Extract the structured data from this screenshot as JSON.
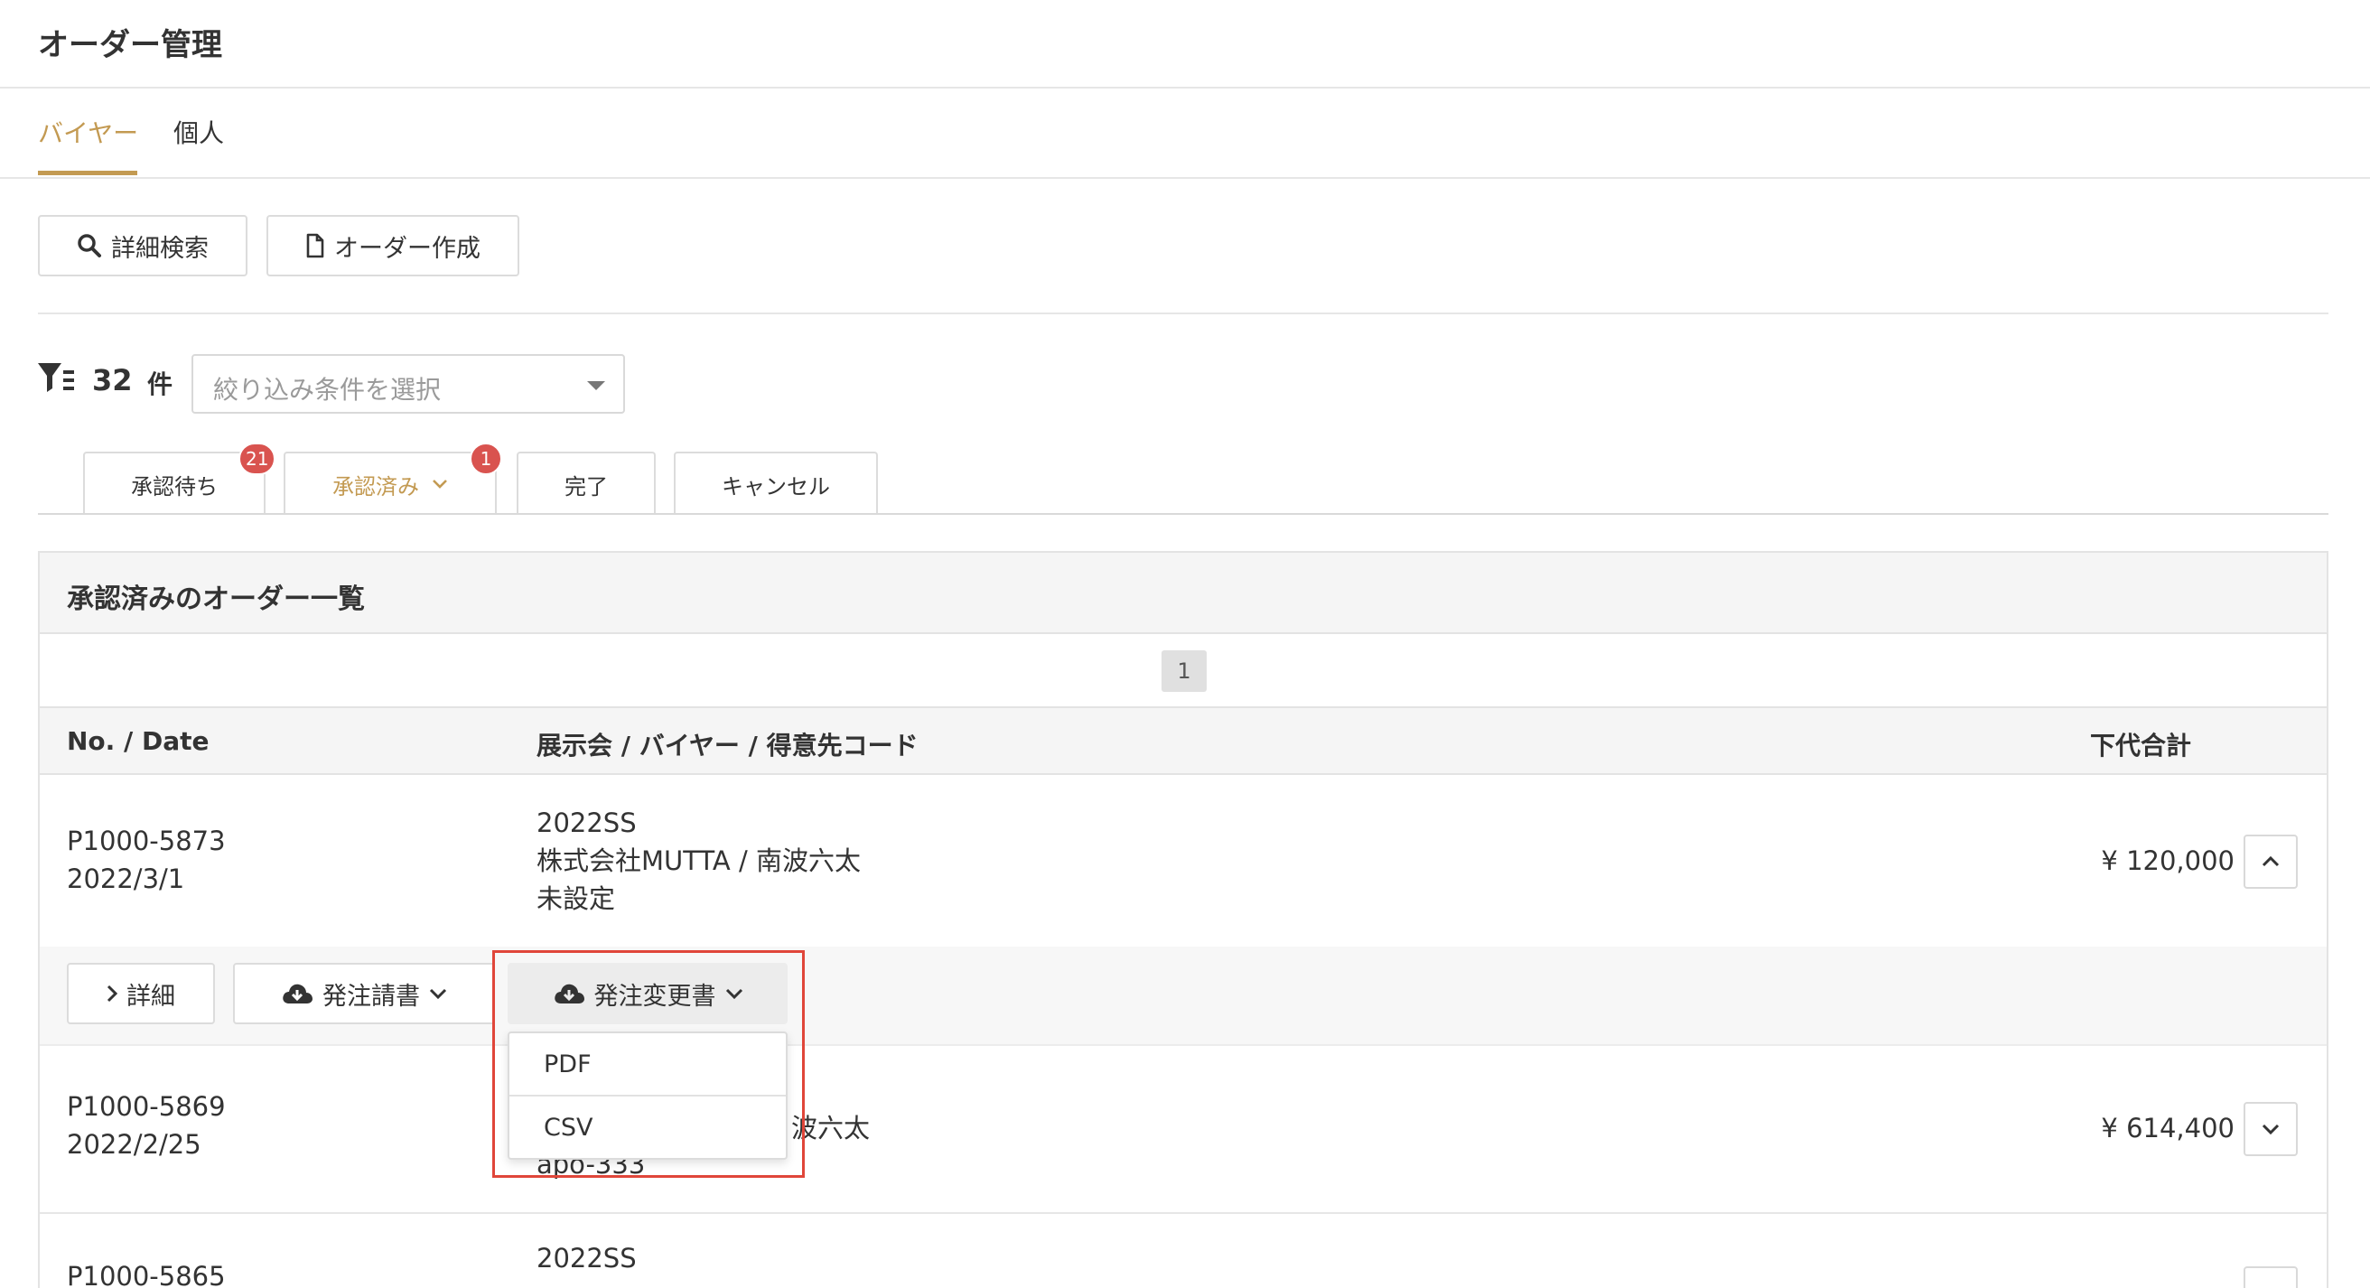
{
  "page": {
    "title": "オーダー管理"
  },
  "top_tabs": [
    {
      "label": "バイヤー",
      "active": true
    },
    {
      "label": "個人",
      "active": false
    }
  ],
  "toolbar": {
    "search_label": "詳細検索",
    "create_label": "オーダー作成"
  },
  "filter": {
    "count": "32",
    "unit": "件",
    "placeholder": "絞り込み条件を選択"
  },
  "status_tabs": [
    {
      "label": "承認待ち",
      "badge": "21"
    },
    {
      "label": "承認済み",
      "badge": "1",
      "active": true
    },
    {
      "label": "完了"
    },
    {
      "label": "キャンセル"
    }
  ],
  "panel": {
    "title": "承認済みのオーダー一覧",
    "page": "1"
  },
  "columns": {
    "no_date": "No. / Date",
    "info": "展示会 / バイヤー / 得意先コード",
    "total": "下代合計"
  },
  "rows": [
    {
      "no": "P1000-5873",
      "date": "2022/3/1",
      "exhibition": "2022SS",
      "buyer": "株式会社MUTTA / 南波六太",
      "code": "未設定",
      "total": "¥ 120,000",
      "expanded": true
    },
    {
      "no": "P1000-5869",
      "date": "2022/2/25",
      "buyer_partial": "波六太",
      "code": "apo-333",
      "total": "¥ 614,400"
    },
    {
      "no": "P1000-5865",
      "exhibition": "2022SS"
    }
  ],
  "row_actions": {
    "detail": "詳細",
    "order_form": "発注請書",
    "change_form": "発注変更書"
  },
  "export_menu": [
    "PDF",
    "CSV"
  ],
  "colors": {
    "accent": "#c39a52",
    "badge": "#d9534f",
    "highlight": "#e0463a"
  }
}
